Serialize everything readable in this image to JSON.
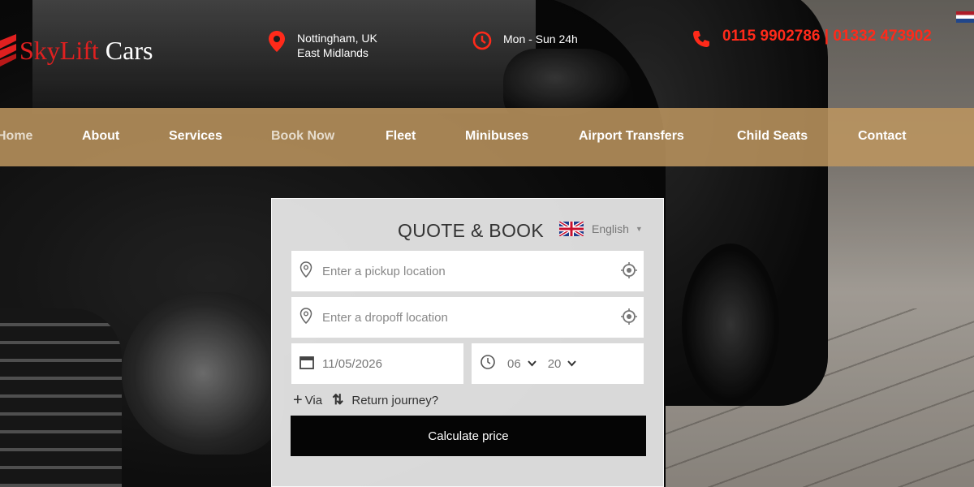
{
  "brand": {
    "name_part1": "SkyLift",
    "name_part2": " Cars",
    "accent": "#e02020"
  },
  "header": {
    "location_line1": "Nottingham, UK",
    "location_line2": "East Midlands",
    "hours": "Mon - Sun 24h",
    "phone": "0115 9902786 | 01332 473902",
    "icons": {
      "location": "map-pin-icon",
      "hours": "clock-icon",
      "phone": "phone-icon"
    }
  },
  "nav": {
    "items": [
      "Home",
      "About",
      "Services",
      "Book Now",
      "Fleet",
      "Minibuses",
      "Airport Transfers",
      "Child Seats",
      "Contact"
    ],
    "bar_color": "#be965f"
  },
  "booking": {
    "title": "QUOTE & BOOK",
    "language": "English",
    "pickup_placeholder": "Enter a pickup location",
    "dropoff_placeholder": "Enter a dropoff location",
    "date": "11/05/2026",
    "hour": "06",
    "minute": "20",
    "via_label": "Via",
    "return_label": "Return journey?",
    "submit_label": "Calculate price"
  }
}
